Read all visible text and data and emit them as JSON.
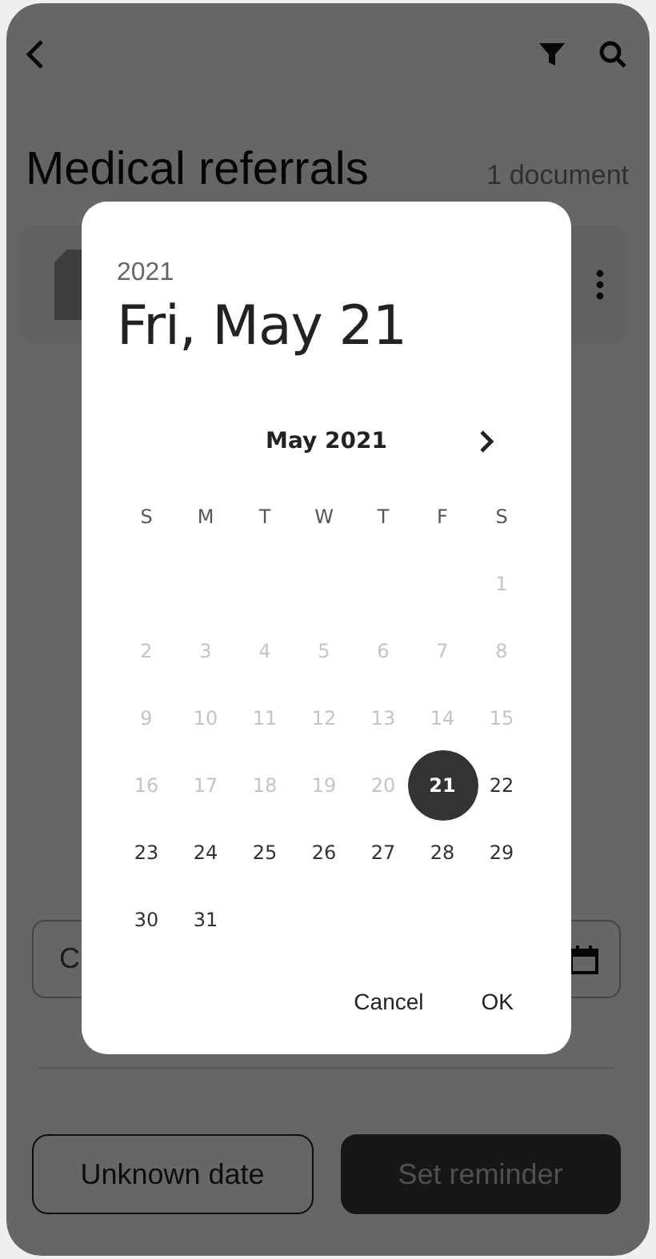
{
  "header": {
    "title": "Medical referrals",
    "count": "1 document"
  },
  "sheet": {
    "field": {
      "value": "C"
    },
    "buttons": [
      {
        "label": "Unknown date",
        "kind": "outline"
      },
      {
        "label": "Set reminder",
        "kind": "filled"
      }
    ]
  },
  "dialog": {
    "year": "2021",
    "date": "Fri, May 21",
    "month": "May 2021",
    "weekdays": [
      "S",
      "M",
      "T",
      "W",
      "T",
      "F",
      "S"
    ],
    "weeks": [
      {
        "days": [
          {
            "label": "1",
            "disabled": true,
            "selected": false
          }
        ]
      },
      {
        "days": [
          {
            "label": "2",
            "disabled": true,
            "selected": false
          },
          {
            "label": "3",
            "disabled": true,
            "selected": false
          },
          {
            "label": "4",
            "disabled": true,
            "selected": false
          },
          {
            "label": "5",
            "disabled": true,
            "selected": false
          },
          {
            "label": "6",
            "disabled": true,
            "selected": false
          },
          {
            "label": "7",
            "disabled": true,
            "selected": false
          },
          {
            "label": "8",
            "disabled": true,
            "selected": false
          }
        ]
      },
      {
        "days": [
          {
            "label": "9",
            "disabled": true,
            "selected": false
          },
          {
            "label": "10",
            "disabled": true,
            "selected": false
          },
          {
            "label": "11",
            "disabled": true,
            "selected": false
          },
          {
            "label": "12",
            "disabled": true,
            "selected": false
          },
          {
            "label": "13",
            "disabled": true,
            "selected": false
          },
          {
            "label": "14",
            "disabled": true,
            "selected": false
          },
          {
            "label": "15",
            "disabled": true,
            "selected": false
          }
        ]
      },
      {
        "days": [
          {
            "label": "16",
            "disabled": true,
            "selected": false
          },
          {
            "label": "17",
            "disabled": true,
            "selected": false
          },
          {
            "label": "18",
            "disabled": true,
            "selected": false
          },
          {
            "label": "19",
            "disabled": true,
            "selected": false
          },
          {
            "label": "20",
            "disabled": true,
            "selected": false
          },
          {
            "label": "21",
            "disabled": false,
            "selected": true
          },
          {
            "label": "22",
            "disabled": false,
            "selected": false
          }
        ]
      },
      {
        "days": [
          {
            "label": "23",
            "disabled": false,
            "selected": false
          },
          {
            "label": "24",
            "disabled": false,
            "selected": false
          },
          {
            "label": "25",
            "disabled": false,
            "selected": false
          },
          {
            "label": "26",
            "disabled": false,
            "selected": false
          },
          {
            "label": "27",
            "disabled": false,
            "selected": false
          },
          {
            "label": "28",
            "disabled": false,
            "selected": false
          },
          {
            "label": "29",
            "disabled": false,
            "selected": false
          }
        ]
      },
      {
        "days": [
          {
            "label": "30",
            "disabled": false,
            "selected": false
          },
          {
            "label": "31",
            "disabled": false,
            "selected": false
          }
        ]
      }
    ],
    "actions": [
      "Cancel",
      "OK"
    ]
  }
}
